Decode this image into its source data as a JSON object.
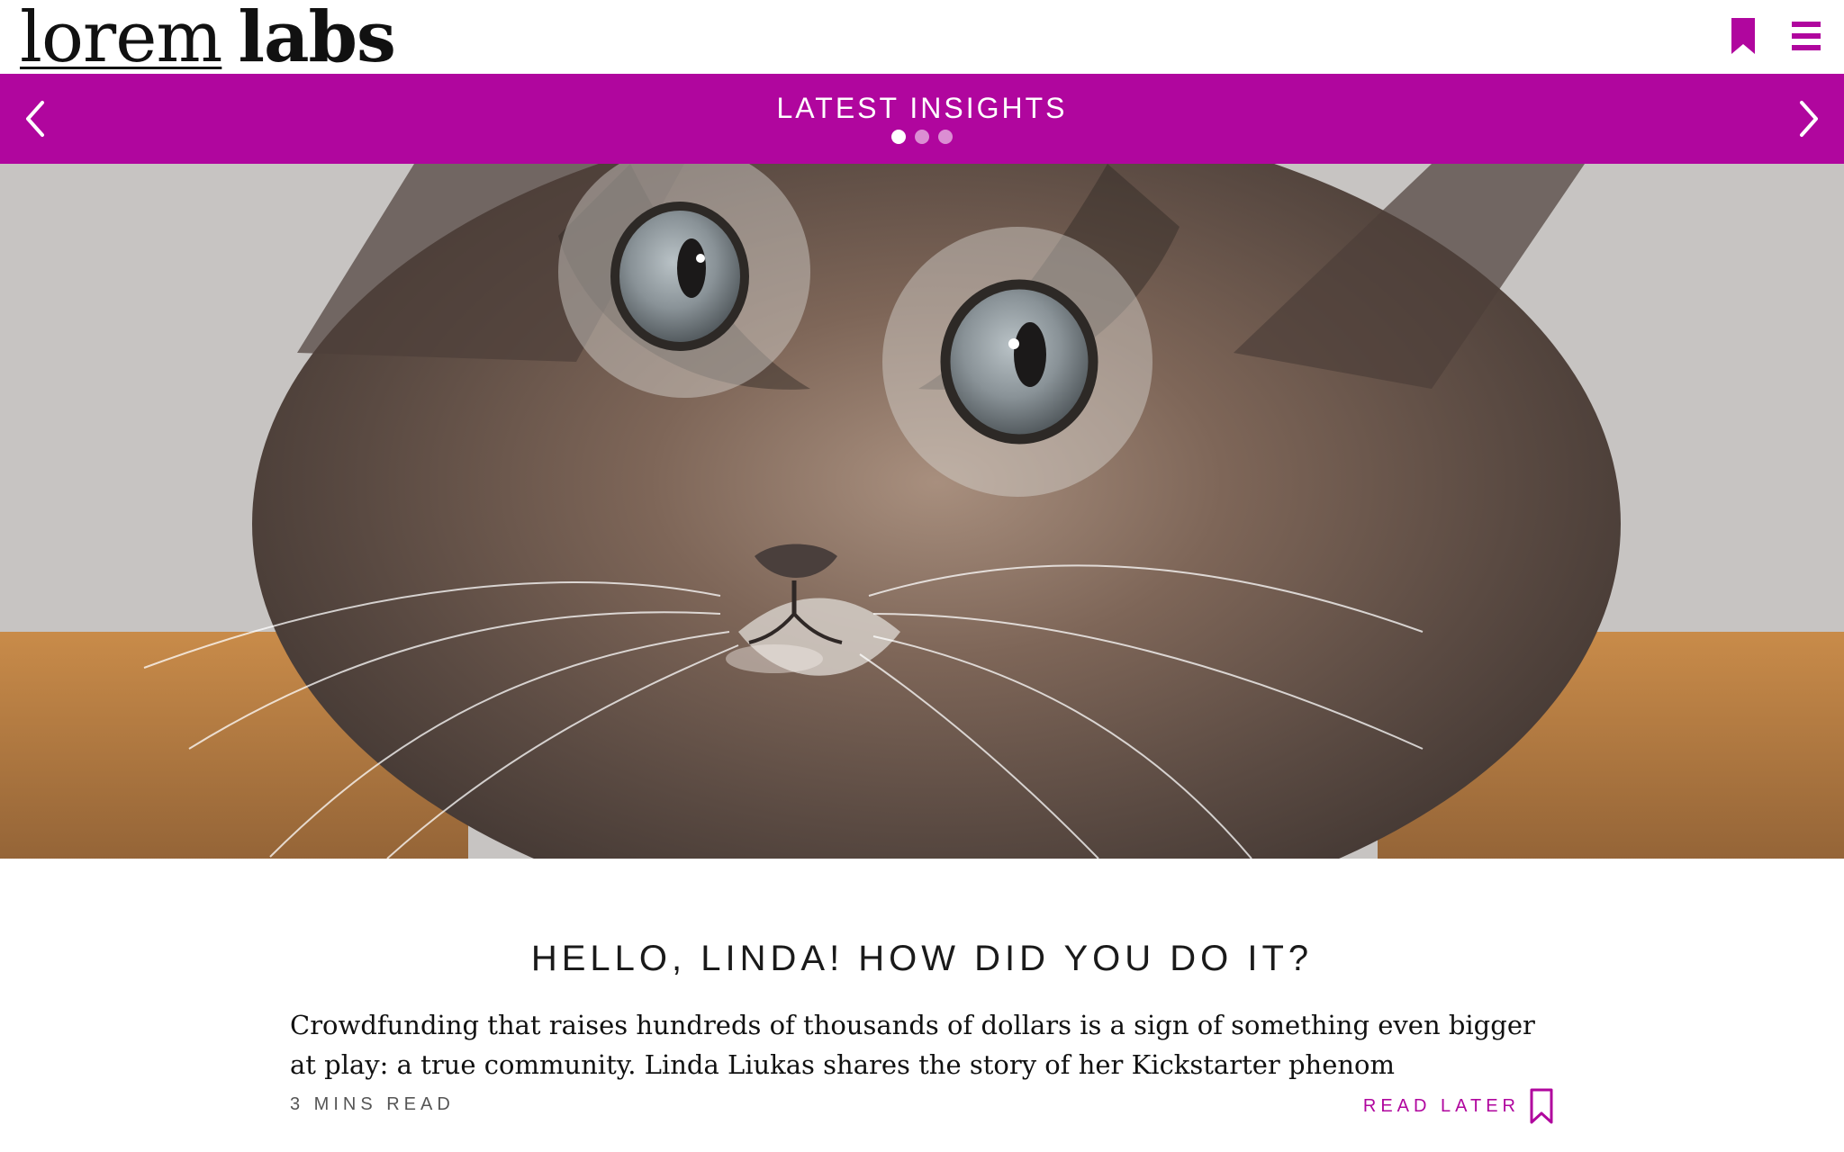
{
  "header": {
    "logo_primary": "lorem",
    "logo_secondary": "labs",
    "icons": {
      "bookmark": "bookmark-icon",
      "menu": "menu-icon"
    },
    "accent_color": "#b0069e"
  },
  "insights": {
    "title": "LATEST INSIGHTS",
    "prev_icon": "chevron-left-icon",
    "next_icon": "chevron-right-icon",
    "dots": [
      {
        "active": true
      },
      {
        "active": false
      },
      {
        "active": false
      }
    ]
  },
  "article": {
    "title": "HELLO, LINDA! HOW DID YOU DO IT?",
    "summary": "Crowdfunding that raises hundreds of thousands of dollars is a sign of something even bigger at play: a true community. Linda Liukas shares the story of her Kickstarter phenom",
    "read_time": "3 MINS READ",
    "read_later_label": "READ LATER",
    "read_later_icon": "bookmark-outline-icon"
  }
}
